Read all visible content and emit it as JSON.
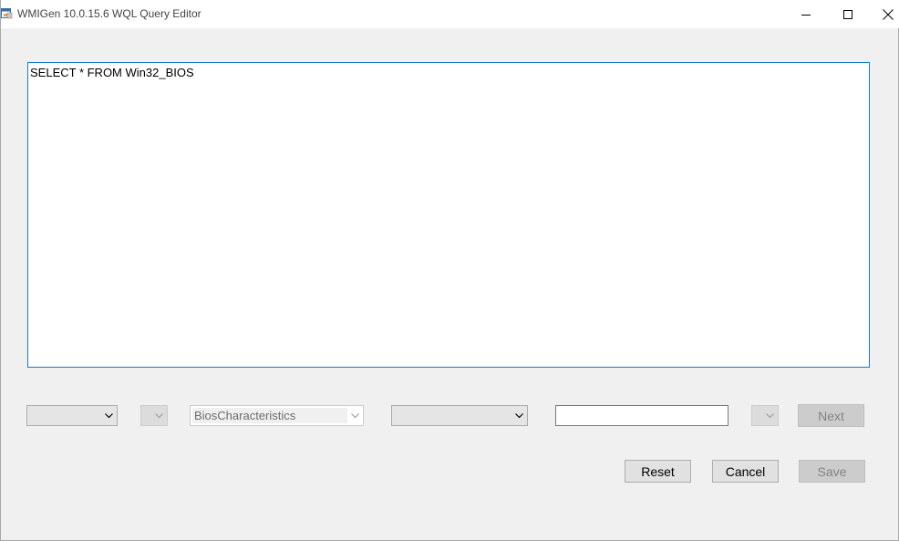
{
  "window": {
    "title": "WMIGen 10.0.15.6 WQL Query Editor",
    "icon": "app-window-icon"
  },
  "caption_buttons": {
    "minimize": "minimize-icon",
    "maximize": "maximize-icon",
    "close": "close-icon"
  },
  "editor": {
    "query_text": "SELECT * FROM Win32_BIOS"
  },
  "filter_row": {
    "combo_1_value": "",
    "combo_2_value": "",
    "property_value": "BiosCharacteristics",
    "combo_4_value": "",
    "value_text": "",
    "combo_5_value": "",
    "next_label": "Next"
  },
  "actions": {
    "reset_label": "Reset",
    "cancel_label": "Cancel",
    "save_label": "Save"
  },
  "colors": {
    "accent_border": "#1e78c8",
    "window_bg": "#f0f0f0",
    "button_bg": "#e1e1e1",
    "disabled_text": "#838383"
  }
}
